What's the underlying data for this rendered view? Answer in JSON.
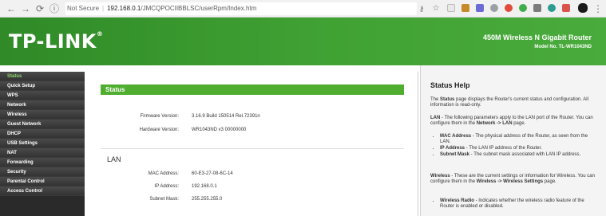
{
  "browser": {
    "security": "Not Secure",
    "url_host": "192.168.0.1",
    "url_path": "/JMCQPOCIIBBLSC/userRpm/Index.htm"
  },
  "header": {
    "logo": "TP-LINK",
    "product": "450M Wireless N Gigabit Router",
    "model": "Model No. TL-WR1043ND"
  },
  "sidebar": {
    "items": [
      {
        "label": "Status",
        "active": true
      },
      {
        "label": "Quick Setup"
      },
      {
        "label": "WPS"
      },
      {
        "label": "Network"
      },
      {
        "label": "Wireless"
      },
      {
        "label": "Guest Network"
      },
      {
        "label": "DHCP"
      },
      {
        "label": "USB Settings"
      },
      {
        "label": "NAT"
      },
      {
        "label": "Forwarding"
      },
      {
        "label": "Security"
      },
      {
        "label": "Parental Control"
      },
      {
        "label": "Access Control"
      }
    ]
  },
  "main": {
    "title": "Status",
    "firmware_label": "Firmware Version:",
    "firmware_value": "3.16.9 Build 150514 Rel.72391n",
    "hardware_label": "Hardware Version:",
    "hardware_value": "WR1043ND v3 00000000",
    "lan_title": "LAN",
    "mac_label": "MAC Address:",
    "mac_value": "60-E3-27-08-6C-14",
    "ip_label": "IP Address:",
    "ip_value": "192.168.0.1",
    "subnet_label": "Subnet Mask:",
    "subnet_value": "255.255.255.0"
  },
  "help": {
    "title": "Status Help",
    "p1_pre": "The ",
    "p1_bold": "Status",
    "p1_post": " page displays the Router's current status and configuration. All information is read-only.",
    "p2_bold": "LAN",
    "p2_post": " - The following parameters apply to the LAN port of the Router. You can configure them in the ",
    "p2_link": "Network -> LAN",
    "p2_end": " page.",
    "lan_items": [
      {
        "term": "MAC Address",
        "desc": " - The physical address of the Router, as seen from the LAN."
      },
      {
        "term": "IP Address",
        "desc": " - The LAN IP address of the Router."
      },
      {
        "term": "Subnet Mask",
        "desc": " - The subnet mask associated with LAN IP address."
      }
    ],
    "p3_bold": "Wireless",
    "p3_post": " - These are the current settings or information for Wireless. You can configure them in the ",
    "p3_link": "Wireless -> Wireless Settings",
    "p3_end": " page.",
    "wl_term": "Wireless Radio",
    "wl_desc": " - Indicates whether the wireless radio feature of the Router is enabled or disabled."
  }
}
